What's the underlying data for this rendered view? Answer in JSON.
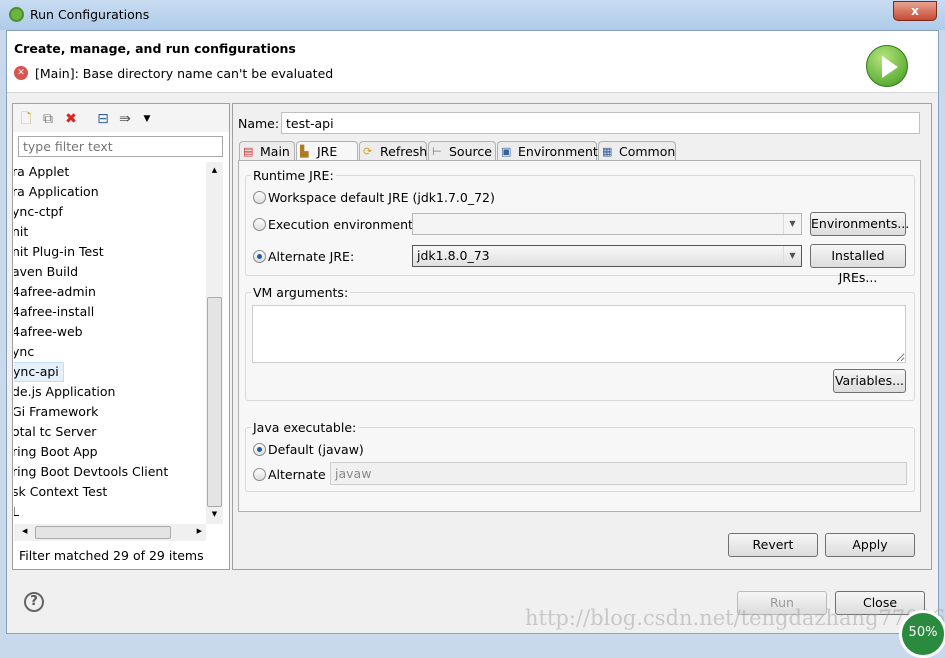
{
  "window": {
    "title": "Run Configurations",
    "close": "x"
  },
  "header": {
    "title": "Create, manage, and run configurations",
    "error": "[Main]: Base directory name can't be evaluated"
  },
  "left": {
    "filter_placeholder": "type filter text",
    "items": [
      "ra Applet",
      "ra Application",
      "ync-ctpf",
      "nit",
      "nit Plug-in Test",
      "aven Build",
      "4afree-admin",
      "4afree-install",
      "4afree-web",
      "ync",
      "ync-api",
      "de.js Application",
      "Gi Framework",
      "otal tc Server",
      "ring Boot App",
      "ring Boot Devtools Client",
      "sk Context Test",
      "L"
    ],
    "selected": "ync-api",
    "status": "Filter matched 29 of 29 items"
  },
  "config": {
    "name_label": "Name:",
    "name_value": "test-api",
    "tabs": [
      {
        "label": "Main",
        "icon": "main-tab-icon"
      },
      {
        "label": "JRE",
        "icon": "jre-icon"
      },
      {
        "label": "Refresh",
        "icon": "refresh-icon"
      },
      {
        "label": "Source",
        "icon": "source-icon"
      },
      {
        "label": "Environment",
        "icon": "environment-icon"
      },
      {
        "label": "Common",
        "icon": "common-icon"
      }
    ],
    "active_tab": "JRE",
    "runtime_jre": {
      "label": "Runtime JRE:",
      "workspace_default": "Workspace default JRE (jdk1.7.0_72)",
      "execution_env": "Execution environment:",
      "execution_env_value": "",
      "environments_btn": "Environments...",
      "alternate": "Alternate JRE:",
      "alternate_value": "jdk1.8.0_73",
      "installed_btn": "Installed JREs...",
      "selected": "alternate"
    },
    "vm_args": {
      "label": "VM arguments:",
      "value": "",
      "variables_btn": "Variables..."
    },
    "java_exec": {
      "label": "Java executable:",
      "default": "Default (javaw)",
      "alternate": "Alternate",
      "alternate_value": "javaw",
      "selected": "default"
    },
    "revert": "Revert",
    "apply": "Apply"
  },
  "footer": {
    "run": "Run",
    "close": "Close",
    "help": "?"
  },
  "overlay": {
    "watermark": "http://blog.csdn.net/tengdazhang770960436",
    "badge": "50%"
  }
}
